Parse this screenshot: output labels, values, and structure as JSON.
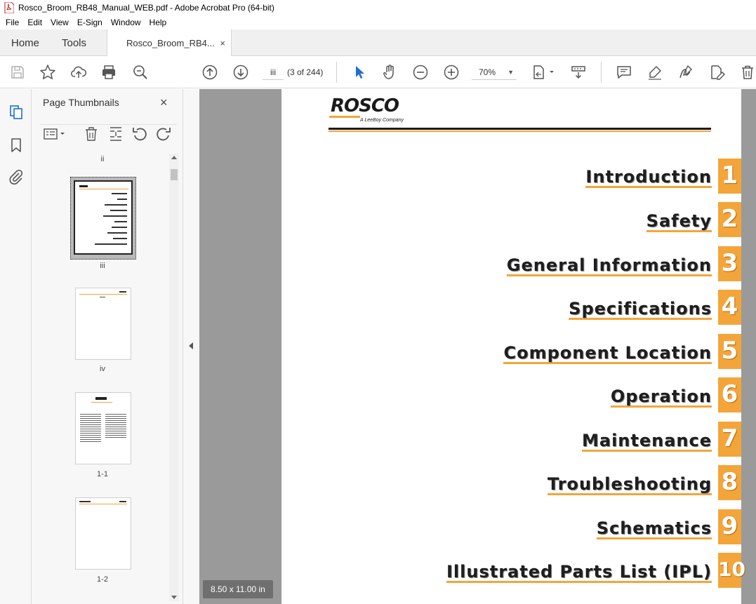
{
  "window": {
    "title": "Rosco_Broom_RB48_Manual_WEB.pdf - Adobe Acrobat Pro (64-bit)"
  },
  "menu": {
    "items": [
      "File",
      "Edit",
      "View",
      "E-Sign",
      "Window",
      "Help"
    ]
  },
  "tabs": {
    "home": "Home",
    "tools": "Tools",
    "document": "Rosco_Broom_RB4...",
    "close": "×"
  },
  "toolbar": {
    "page_input": "iii",
    "page_count": "(3 of 244)",
    "zoom": "70%",
    "icons": [
      "save-icon",
      "bookmark-star-icon",
      "upload-icon",
      "print-icon",
      "search-zoom-icon",
      "page-up-icon",
      "page-down-icon",
      "select-arrow-icon",
      "hand-icon",
      "zoom-out-icon",
      "zoom-in-icon",
      "page-fit-icon",
      "scroll-mode-icon",
      "comment-icon",
      "highlight-icon",
      "sign-icon",
      "edit-pdf-icon",
      "delete-icon"
    ]
  },
  "sidebar": {
    "title": "Page Thumbnails",
    "close": "×",
    "labels": [
      "ii",
      "iii",
      "iv",
      "1-1",
      "1-2"
    ]
  },
  "document": {
    "page_size": "8.50 x 11.00 in",
    "logo_text": "ROSCO",
    "logo_sub": "A LeeBoy Company",
    "toc": [
      {
        "title": "Introduction",
        "num": "1"
      },
      {
        "title": "Safety",
        "num": "2"
      },
      {
        "title": "General Information",
        "num": "3"
      },
      {
        "title": "Specifications",
        "num": "4"
      },
      {
        "title": "Component Location",
        "num": "5"
      },
      {
        "title": "Operation",
        "num": "6"
      },
      {
        "title": "Maintenance",
        "num": "7"
      },
      {
        "title": "Troubleshooting",
        "num": "8"
      },
      {
        "title": "Schematics",
        "num": "9"
      },
      {
        "title": "Illustrated Parts List (IPL)",
        "num": "10"
      }
    ],
    "accent_color": "#f4a53a"
  }
}
